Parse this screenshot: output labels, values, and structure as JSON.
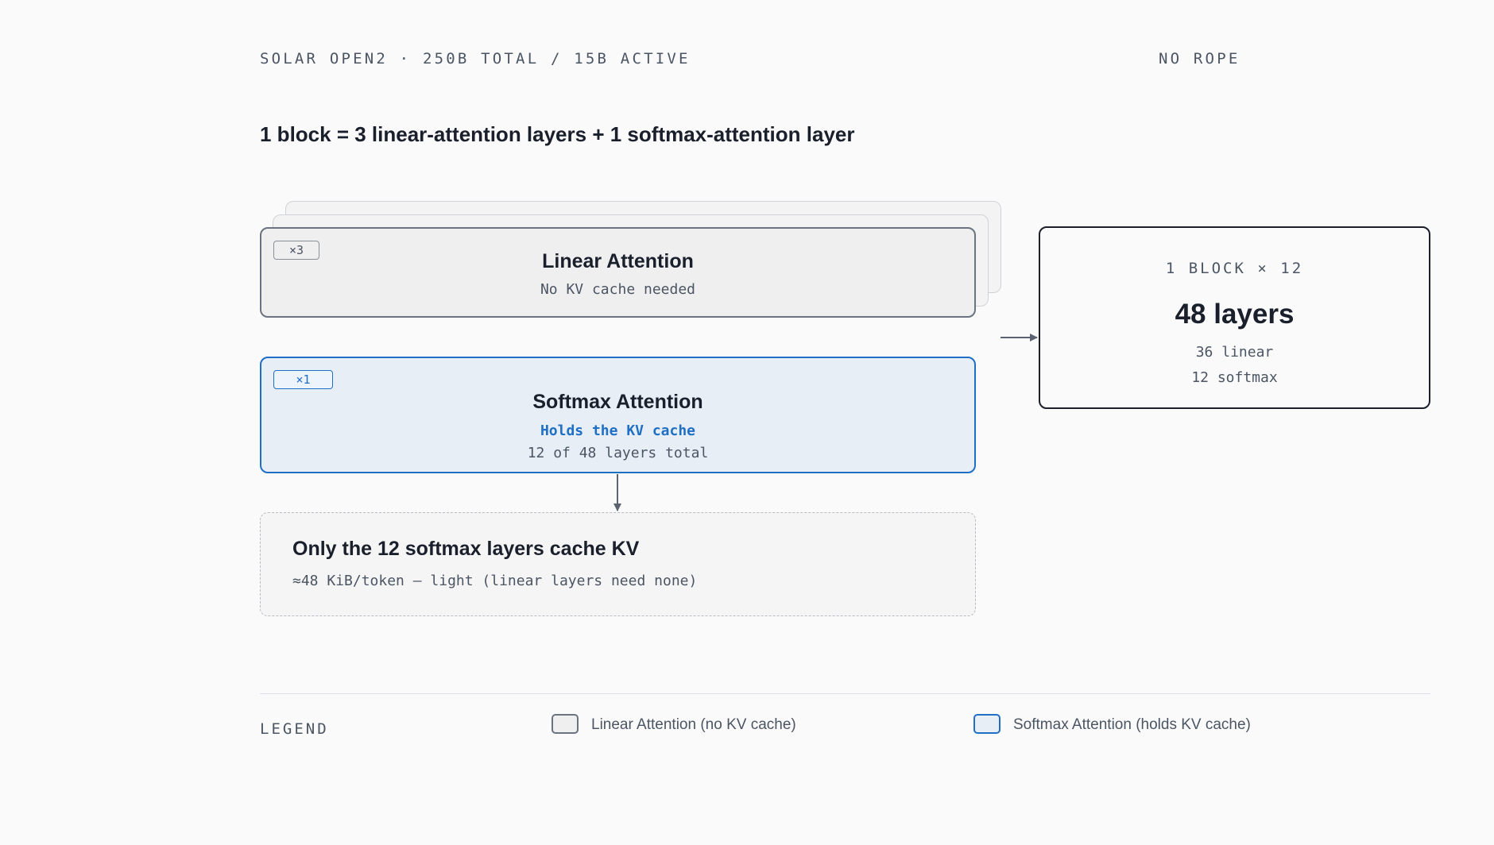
{
  "header": {
    "left_label": "SOLAR OPEN2 · 250B TOTAL / 15B ACTIVE",
    "right_label": "NO ROPE"
  },
  "subtitle": "1 block = 3 linear-attention layers + 1 softmax-attention layer",
  "linear_card": {
    "badge": "×3",
    "title": "Linear Attention",
    "subtitle": "No KV cache needed"
  },
  "softmax_card": {
    "badge": "×1",
    "title": "Softmax Attention",
    "highlight": "Holds the KV cache",
    "subtitle": "12 of 48 layers total"
  },
  "kv_note": {
    "title": "Only the 12 softmax layers cache KV",
    "subtitle": "≈48 KiB/token — light (linear layers need none)"
  },
  "summary": {
    "head": "1 BLOCK × 12",
    "total": "48 layers",
    "linear_count": "36 linear",
    "softmax_count": "12 softmax"
  },
  "legend": {
    "label": "LEGEND",
    "items": [
      {
        "label": "Linear Attention (no KV cache)"
      },
      {
        "label": "Softmax Attention (holds KV cache)"
      }
    ]
  },
  "colors": {
    "accent_blue": "#1f6fc5",
    "ink": "#1a1f2c",
    "muted": "#4b5563",
    "linear_fill": "#efefef",
    "softmax_fill": "#e7eef6"
  }
}
